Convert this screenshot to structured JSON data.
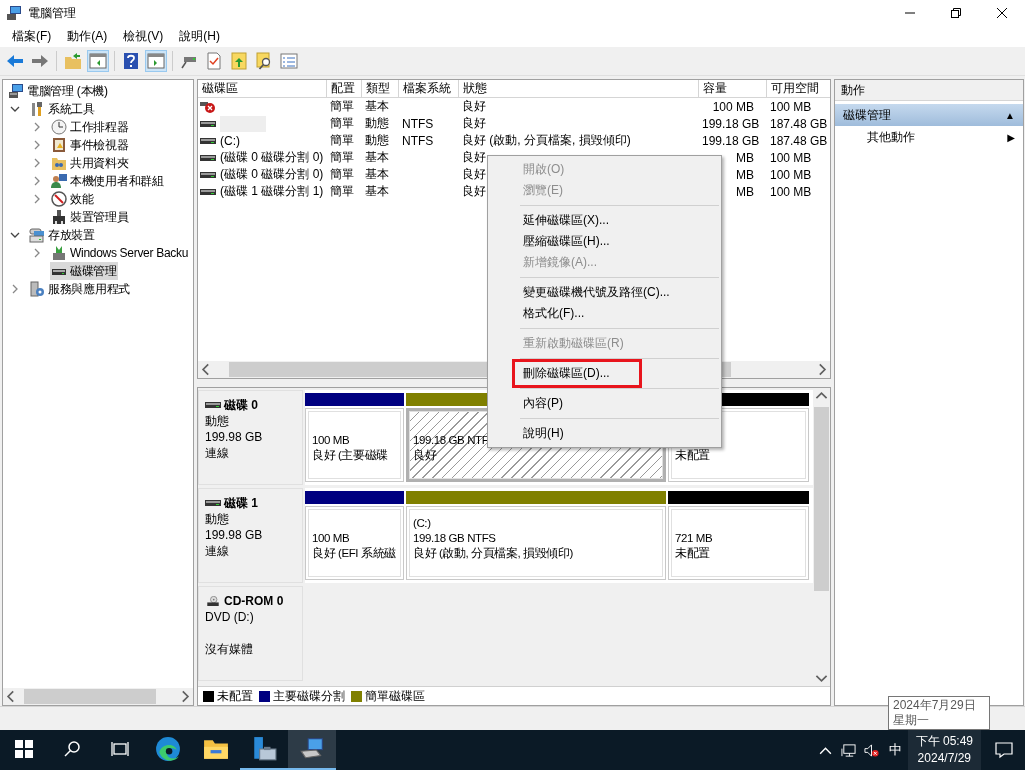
{
  "window": {
    "title": "電腦管理"
  },
  "menu": [
    "檔案(F)",
    "動作(A)",
    "檢視(V)",
    "說明(H)"
  ],
  "toolbar": [
    {
      "kind": "back",
      "pressed": false
    },
    {
      "kind": "forward",
      "pressed": false
    },
    {
      "kind": "sep"
    },
    {
      "kind": "up",
      "pressed": false
    },
    {
      "kind": "tree-pane",
      "pressed": true
    },
    {
      "kind": "sep"
    },
    {
      "kind": "help",
      "pressed": false
    },
    {
      "kind": "action-pane",
      "pressed": true
    },
    {
      "kind": "sep"
    },
    {
      "kind": "connect",
      "pressed": false
    },
    {
      "kind": "check",
      "pressed": false
    },
    {
      "kind": "export",
      "pressed": false
    },
    {
      "kind": "find",
      "pressed": false
    },
    {
      "kind": "list",
      "pressed": false
    }
  ],
  "tree": [
    {
      "label": "電腦管理 (本機)",
      "expandable": false,
      "selected": false,
      "children": [
        {
          "label": "系統工具",
          "expandable": true,
          "expanded": true,
          "selected": false,
          "children": [
            {
              "label": "工作排程器",
              "expandable": true,
              "expanded": false,
              "selected": false
            },
            {
              "label": "事件檢視器",
              "expandable": true,
              "expanded": false,
              "selected": false
            },
            {
              "label": "共用資料夾",
              "expandable": true,
              "expanded": false,
              "selected": false
            },
            {
              "label": "本機使用者和群組",
              "expandable": true,
              "expanded": false,
              "selected": false
            },
            {
              "label": "效能",
              "expandable": true,
              "expanded": false,
              "selected": false
            },
            {
              "label": "裝置管理員",
              "expandable": false,
              "selected": false
            }
          ]
        },
        {
          "label": "存放裝置",
          "expandable": true,
          "expanded": true,
          "selected": false,
          "children": [
            {
              "label": "Windows Server Backu",
              "expandable": true,
              "expanded": false,
              "selected": false
            },
            {
              "label": "磁碟管理",
              "expandable": false,
              "selected": true
            }
          ]
        },
        {
          "label": "服務與應用程式",
          "expandable": true,
          "expanded": false,
          "selected": false
        }
      ]
    }
  ],
  "volumes": {
    "columns": [
      "磁碟區",
      "配置",
      "類型",
      "檔案系統",
      "狀態",
      "容量",
      "可用空間"
    ],
    "rows": [
      {
        "kind": "error",
        "layout": "簡單",
        "type": "基本",
        "status": "良好",
        "capacity": "100 MB",
        "free": "100 MB"
      },
      {
        "kind": "redacted",
        "layout": "簡單",
        "type": "動態",
        "fs": "NTFS",
        "status": "良好",
        "capacity": "199.18 GB",
        "free": "187.48 GB"
      },
      {
        "kind": "drive",
        "volume": "(C:)",
        "layout": "簡單",
        "type": "動態",
        "fs": "NTFS",
        "status": "良好 (啟動, 分頁檔案, 損毀傾印)",
        "capacity": "199.18 GB",
        "free": "187.48 GB"
      },
      {
        "kind": "drive",
        "volume": "(磁碟 0 磁碟分割 0)",
        "layout": "簡單",
        "type": "基本",
        "status": "良好",
        "capacity": "MB",
        "free": "100 MB"
      },
      {
        "kind": "drive",
        "volume": "(磁碟 0 磁碟分割 0)",
        "layout": "簡單",
        "type": "基本",
        "status": "良好",
        "capacity": "MB",
        "free": "100 MB"
      },
      {
        "kind": "drive",
        "volume": "(磁碟 1 磁碟分割 1)",
        "layout": "簡單",
        "type": "基本",
        "status": "良好",
        "capacity": "MB",
        "free": "100 MB"
      }
    ]
  },
  "disks": [
    {
      "kind": "disk",
      "name": "磁碟 0",
      "lines": [
        "動態",
        "199.98 GB",
        "連線"
      ],
      "partitions": [
        {
          "kind": "primary",
          "selected": false,
          "lines": [
            "100 MB",
            "良好 (主要磁碟"
          ]
        },
        {
          "kind": "simple",
          "selected": true,
          "lines": [
            "199.18 GB NTF",
            "良好"
          ]
        },
        {
          "kind": "unallocated",
          "selected": false,
          "lines": [
            "未配置"
          ]
        }
      ]
    },
    {
      "kind": "disk",
      "name": "磁碟 1",
      "lines": [
        "動態",
        "199.98 GB",
        "連線"
      ],
      "partitions": [
        {
          "kind": "primary",
          "selected": false,
          "lines": [
            "100 MB",
            "良好 (EFI 系統磁"
          ]
        },
        {
          "kind": "simple",
          "selected": false,
          "lines": [
            "(C:)",
            "199.18 GB NTFS",
            "良好 (啟動, 分頁檔案, 損毀傾印)"
          ]
        },
        {
          "kind": "unallocated",
          "selected": false,
          "lines": [
            "721 MB",
            "未配置"
          ]
        }
      ]
    },
    {
      "kind": "cdrom",
      "name": "CD-ROM 0",
      "lines": [
        "DVD (D:)"
      ],
      "status": "沒有媒體"
    }
  ],
  "legend": [
    {
      "label": "未配置",
      "color": "#000000"
    },
    {
      "label": "主要磁碟分割",
      "color": "#000080"
    },
    {
      "label": "簡單磁碟區",
      "color": "#808000"
    }
  ],
  "context_menu": [
    {
      "kind": "item",
      "label": "開啟(O)",
      "disabled": true,
      "highlighted": false
    },
    {
      "kind": "item",
      "label": "瀏覽(E)",
      "disabled": true,
      "highlighted": false
    },
    {
      "kind": "separator"
    },
    {
      "kind": "item",
      "label": "延伸磁碟區(X)...",
      "disabled": false,
      "highlighted": false
    },
    {
      "kind": "item",
      "label": "壓縮磁碟區(H)...",
      "disabled": false,
      "highlighted": false
    },
    {
      "kind": "item",
      "label": "新增鏡像(A)...",
      "disabled": true,
      "highlighted": false
    },
    {
      "kind": "separator"
    },
    {
      "kind": "item",
      "label": "變更磁碟機代號及路徑(C)...",
      "disabled": false,
      "highlighted": false
    },
    {
      "kind": "item",
      "label": "格式化(F)...",
      "disabled": false,
      "highlighted": false
    },
    {
      "kind": "separator"
    },
    {
      "kind": "item",
      "label": "重新啟動磁碟區(R)",
      "disabled": true,
      "highlighted": false
    },
    {
      "kind": "separator"
    },
    {
      "kind": "item",
      "label": "刪除磁碟區(D)...",
      "disabled": false,
      "highlighted": true
    },
    {
      "kind": "separator"
    },
    {
      "kind": "item",
      "label": "內容(P)",
      "disabled": false,
      "highlighted": false
    },
    {
      "kind": "separator"
    },
    {
      "kind": "item",
      "label": "說明(H)",
      "disabled": false,
      "highlighted": false
    }
  ],
  "actions": {
    "title": "動作",
    "section": {
      "label": "磁碟管理",
      "glyph": "▲",
      "expanded": true
    },
    "items": [
      {
        "label": "其他動作",
        "glyph": "▶"
      }
    ]
  },
  "tooltip": {
    "lines": [
      "2024年7月29日",
      "星期一"
    ]
  },
  "taskbar": {
    "apps": [
      {
        "kind": "start",
        "selected": false,
        "running": false
      },
      {
        "kind": "search",
        "selected": false,
        "running": false
      },
      {
        "kind": "taskview",
        "selected": false,
        "running": false
      },
      {
        "kind": "edge",
        "selected": false,
        "running": false
      },
      {
        "kind": "explorer",
        "selected": false,
        "running": false
      },
      {
        "kind": "server",
        "selected": false,
        "running": true
      },
      {
        "kind": "computer",
        "selected": true,
        "running": true
      }
    ],
    "ime": "中",
    "time": "下午 05:49",
    "date": "2024/7/29"
  }
}
